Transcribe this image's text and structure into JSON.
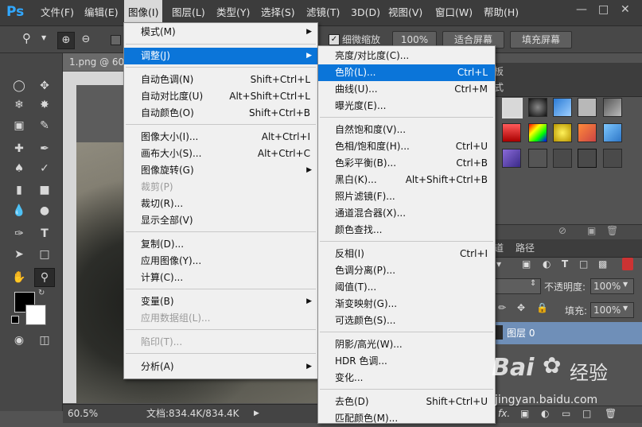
{
  "menubar": {
    "logo": "Ps",
    "items": [
      {
        "label": "文件(F)"
      },
      {
        "label": "编辑(E)"
      },
      {
        "label": "图像(I)"
      },
      {
        "label": "图层(L)"
      },
      {
        "label": "类型(Y)"
      },
      {
        "label": "选择(S)"
      },
      {
        "label": "滤镜(T)"
      },
      {
        "label": "3D(D)"
      },
      {
        "label": "视图(V)"
      },
      {
        "label": "窗口(W)"
      },
      {
        "label": "帮助(H)"
      }
    ]
  },
  "options_bar": {
    "scrubby_zoom_label": "细微缩放",
    "zoom_value": "100%",
    "fit_screen": "适合屏幕",
    "fill_screen": "填充屏幕"
  },
  "document": {
    "tab_title": "1.png @ 60.",
    "zoom": "60.5%",
    "doc_info": "文档:834.4K/834.4K"
  },
  "image_menu": {
    "items": [
      {
        "label": "模式(M)",
        "shortcut": "",
        "submenu": true,
        "disabled": false
      },
      {
        "label": "调整(J)",
        "shortcut": "",
        "submenu": true,
        "disabled": false,
        "highlighted": true
      },
      {
        "label": "自动色调(N)",
        "shortcut": "Shift+Ctrl+L"
      },
      {
        "label": "自动对比度(U)",
        "shortcut": "Alt+Shift+Ctrl+L"
      },
      {
        "label": "自动颜色(O)",
        "shortcut": "Shift+Ctrl+B"
      },
      {
        "label": "图像大小(I)...",
        "shortcut": "Alt+Ctrl+I"
      },
      {
        "label": "画布大小(S)...",
        "shortcut": "Alt+Ctrl+C"
      },
      {
        "label": "图像旋转(G)",
        "shortcut": "",
        "submenu": true
      },
      {
        "label": "裁剪(P)",
        "shortcut": "",
        "disabled": true
      },
      {
        "label": "裁切(R)...",
        "shortcut": ""
      },
      {
        "label": "显示全部(V)",
        "shortcut": ""
      },
      {
        "label": "复制(D)...",
        "shortcut": ""
      },
      {
        "label": "应用图像(Y)...",
        "shortcut": ""
      },
      {
        "label": "计算(C)...",
        "shortcut": ""
      },
      {
        "label": "变量(B)",
        "shortcut": "",
        "submenu": true
      },
      {
        "label": "应用数据组(L)...",
        "shortcut": "",
        "disabled": true
      },
      {
        "label": "陷印(T)...",
        "shortcut": "",
        "disabled": true
      },
      {
        "label": "分析(A)",
        "shortcut": "",
        "submenu": true
      }
    ]
  },
  "adjust_menu": {
    "items": [
      {
        "label": "亮度/对比度(C)...",
        "shortcut": ""
      },
      {
        "label": "色阶(L)...",
        "shortcut": "Ctrl+L",
        "highlighted": true
      },
      {
        "label": "曲线(U)...",
        "shortcut": "Ctrl+M"
      },
      {
        "label": "曝光度(E)...",
        "shortcut": ""
      },
      {
        "label": "自然饱和度(V)...",
        "shortcut": ""
      },
      {
        "label": "色相/饱和度(H)...",
        "shortcut": "Ctrl+U"
      },
      {
        "label": "色彩平衡(B)...",
        "shortcut": "Ctrl+B"
      },
      {
        "label": "黑白(K)...",
        "shortcut": "Alt+Shift+Ctrl+B"
      },
      {
        "label": "照片滤镜(F)...",
        "shortcut": ""
      },
      {
        "label": "通道混合器(X)...",
        "shortcut": ""
      },
      {
        "label": "颜色查找...",
        "shortcut": ""
      },
      {
        "label": "反相(I)",
        "shortcut": "Ctrl+I"
      },
      {
        "label": "色调分离(P)...",
        "shortcut": ""
      },
      {
        "label": "阈值(T)...",
        "shortcut": ""
      },
      {
        "label": "渐变映射(G)...",
        "shortcut": ""
      },
      {
        "label": "可选颜色(S)...",
        "shortcut": ""
      },
      {
        "label": "阴影/高光(W)...",
        "shortcut": ""
      },
      {
        "label": "HDR 色调...",
        "shortcut": ""
      },
      {
        "label": "变化...",
        "shortcut": ""
      },
      {
        "label": "去色(D)",
        "shortcut": "Shift+Ctrl+U"
      },
      {
        "label": "匹配颜色(M)...",
        "shortcut": ""
      }
    ]
  },
  "panels": {
    "tab_fragment_1": "板",
    "tab_fragment_2": "式",
    "layers_tab_fragment": "道",
    "paths_tab": "路径",
    "opacity_label": "不透明度:",
    "opacity_value": "100%",
    "fill_label": "填充:",
    "fill_value": "100%",
    "layer_name": "图层 0",
    "fx_label": "fx."
  },
  "watermark": {
    "brand": "Bai",
    "brand_suffix": "经验",
    "url": "jingyan.baidu.com"
  },
  "colors": {
    "menu_highlight": "#0b75d9",
    "ps_blue": "#31a8ff"
  }
}
